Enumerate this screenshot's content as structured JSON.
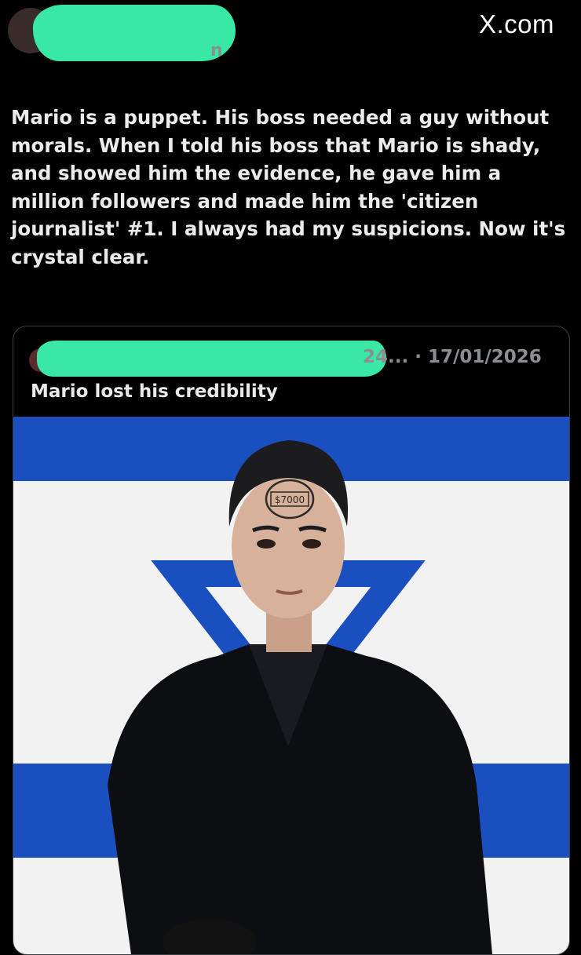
{
  "header": {
    "brand": "X.com",
    "handle_tail": "n"
  },
  "post": {
    "text": "Mario is a puppet. His boss needed a guy without morals. When I told his boss that Mario is shady, and showed him the evidence, he gave him a million followers and made him the 'citizen journalist' #1. I always had my suspicions. Now it's crystal clear."
  },
  "quote": {
    "meta": "24... · 17/01/2026",
    "text": "Mario lost his credibility",
    "image": {
      "stamp_text": "$7000"
    }
  },
  "colors": {
    "background": "#000000",
    "redaction": "#39e8a4",
    "flag_blue": "#1a4fbf",
    "flag_white": "#f2f2f2",
    "muted": "#8b8f94"
  }
}
